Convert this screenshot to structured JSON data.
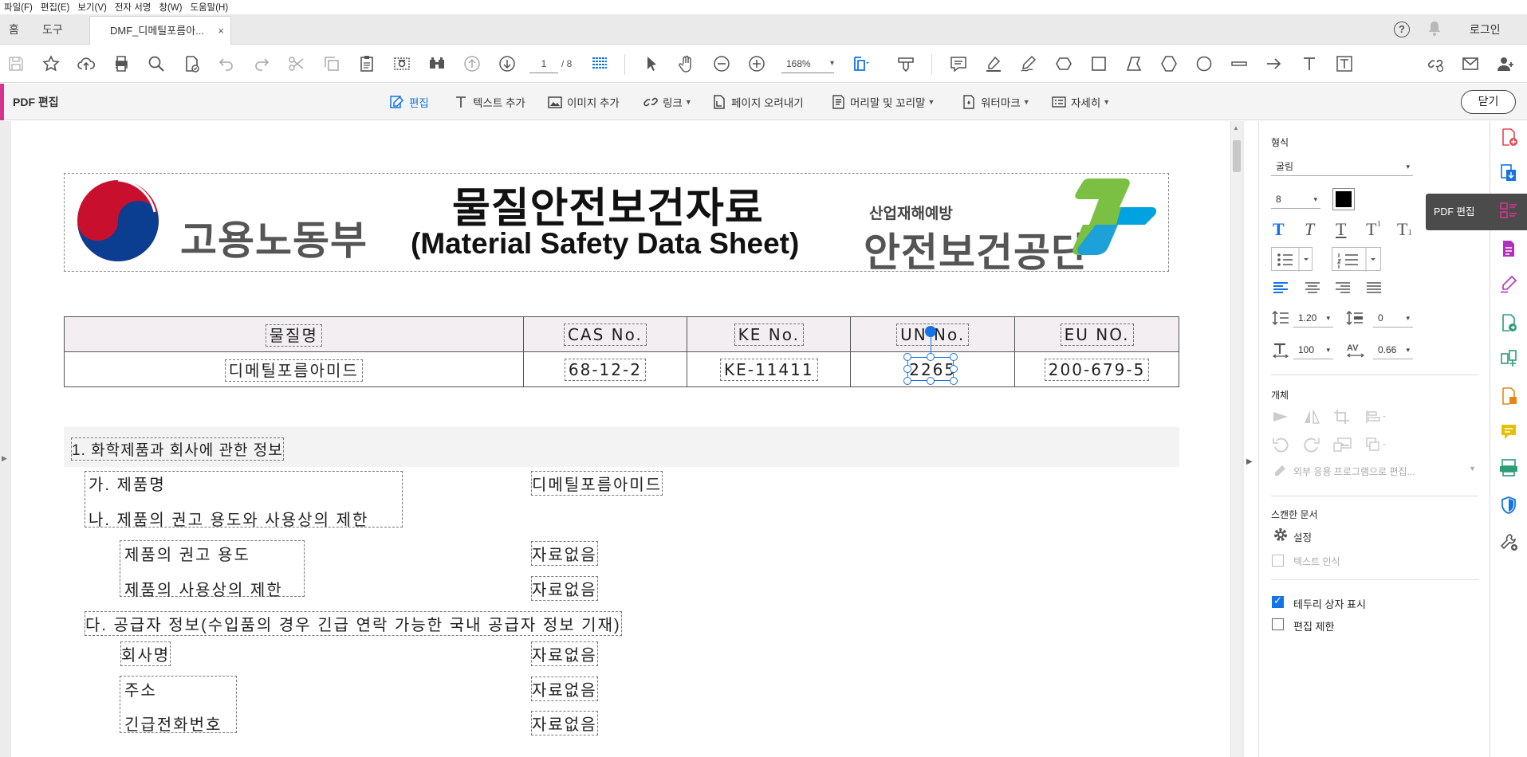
{
  "menu": [
    "파일(F)",
    "편집(E)",
    "보기(V)",
    "전자 서명",
    "창(W)",
    "도움말(H)"
  ],
  "tabs": {
    "home": "홈",
    "tools": "도구",
    "document": "DMF_디메틸포름아...",
    "close": "×",
    "help": "?",
    "login": "로그인"
  },
  "toolbar": {
    "page_current": "1",
    "page_total": "/ 8",
    "zoom": "168%"
  },
  "editbar": {
    "title": "PDF 편집",
    "tools": [
      {
        "label": "편집",
        "caret": false,
        "active": true
      },
      {
        "label": "텍스트 추가",
        "caret": false
      },
      {
        "label": "이미지 추가",
        "caret": false
      },
      {
        "label": "링크",
        "caret": true
      },
      {
        "label": "페이지 오려내기",
        "caret": false
      },
      {
        "label": "머리말 및 꼬리말",
        "caret": true
      },
      {
        "label": "워터마크",
        "caret": true
      },
      {
        "label": "자세히",
        "caret": true
      }
    ],
    "close_label": "닫기"
  },
  "document": {
    "banner": {
      "ministry": "고용노동부",
      "title_ko": "물질안전보건자료",
      "title_en": "(Material Safety Data Sheet)",
      "agency_small": "산업재해예방",
      "agency_big": "안전보건공단"
    },
    "id_table": {
      "headers": [
        "물질명",
        "CAS No.",
        "KE No.",
        "UN No.",
        "EU NO."
      ],
      "values": [
        "디메틸포름아미드",
        "68-12-2",
        "KE-11411",
        "2265",
        "200-679-5"
      ]
    },
    "section1": {
      "title": "1. 화학제품과 회사에 관한 정보",
      "a_label": "가. 제품명",
      "a_value": "디메틸포름아미드",
      "b_label": "나. 제품의 권고 용도와 사용상의 제한",
      "b1_label": "제품의 권고 용도",
      "b1_value": "자료없음",
      "b2_label": "제품의 사용상의 제한",
      "b2_value": "자료없음",
      "c_label": "다. 공급자 정보(수입품의 경우 긴급 연락 가능한 국내 공급자 정보 기재)",
      "c1_label": "회사명",
      "c1_value": "자료없음",
      "c2_label": "주소",
      "c2_value": "자료없음",
      "c3_label": "긴급전화번호",
      "c3_value": "자료없음"
    }
  },
  "right_panel": {
    "format_label": "형식",
    "font": "굴림",
    "font_size": "8",
    "line_spacing": "1.20",
    "para_spacing": "0",
    "scale": "100",
    "char_spacing": "0.66",
    "object_label": "개체",
    "external_edit": "외부 응용 프로그램으로 편집...",
    "scanned_label": "스캔한 문서",
    "settings": "설정",
    "text_recognition": "텍스트 인식",
    "show_bbox": "테두리 상자 표시",
    "restrict_edit": "편집 제한",
    "show_bbox_checked": true,
    "restrict_edit_checked": false,
    "color_swatch": "#000000"
  },
  "rail": {
    "tooltip": "PDF 편집"
  },
  "colors": {
    "accent": "#1473e6",
    "edit_accent": "#d6348d"
  }
}
